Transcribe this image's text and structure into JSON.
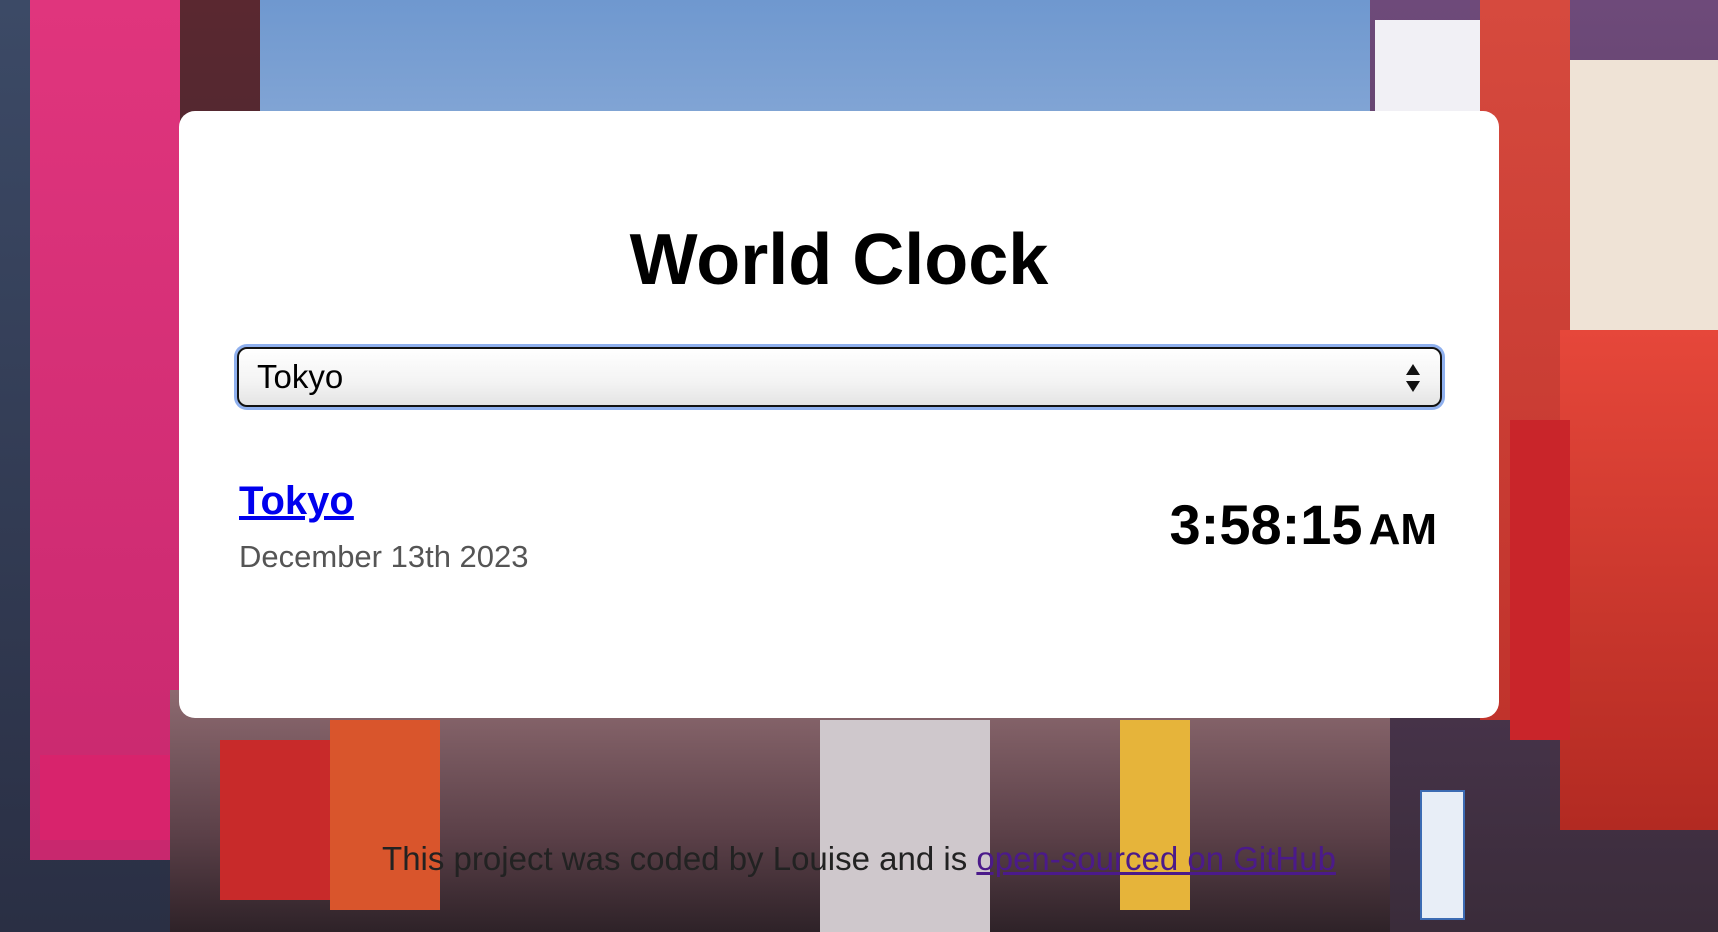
{
  "app": {
    "title": "World Clock"
  },
  "selector": {
    "selected": "Tokyo"
  },
  "city": {
    "name": "Tokyo",
    "date": "December 13th 2023",
    "time": "3:58:15",
    "ampm": "AM"
  },
  "footer": {
    "text": "This project was coded by Louise and is ",
    "link_text": "open-sourced on GitHub"
  },
  "colors": {
    "link": "#0000ee",
    "visited_link": "#4b1a8a",
    "card_bg": "#ffffff",
    "select_focus": "#8fb0ee"
  }
}
